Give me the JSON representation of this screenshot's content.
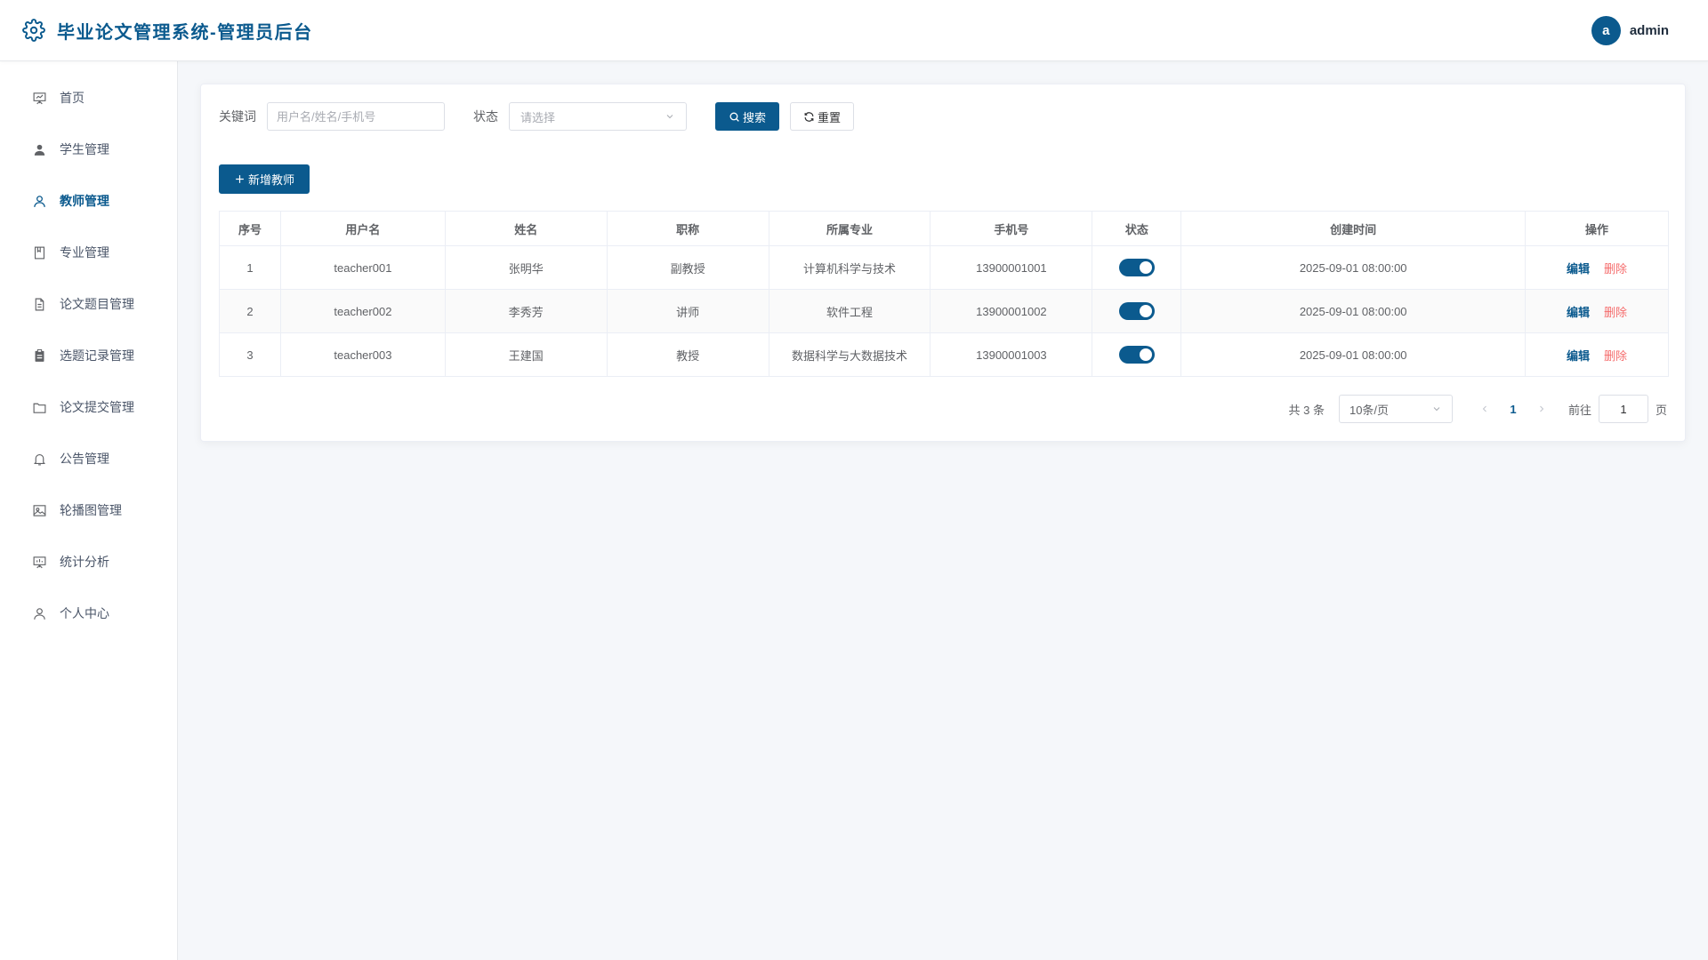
{
  "header": {
    "title": "毕业论文管理系统-管理员后台",
    "avatar_letter": "a",
    "username": "admin"
  },
  "sidebar": {
    "items": [
      {
        "label": "首页",
        "icon": "presentation-icon",
        "active": false
      },
      {
        "label": "学生管理",
        "icon": "user-filled-icon",
        "active": false
      },
      {
        "label": "教师管理",
        "icon": "user-icon",
        "active": true
      },
      {
        "label": "专业管理",
        "icon": "notebook-icon",
        "active": false
      },
      {
        "label": "论文题目管理",
        "icon": "document-icon",
        "active": false
      },
      {
        "label": "选题记录管理",
        "icon": "clipboard-icon",
        "active": false
      },
      {
        "label": "论文提交管理",
        "icon": "folder-icon",
        "active": false
      },
      {
        "label": "公告管理",
        "icon": "bell-icon",
        "active": false
      },
      {
        "label": "轮播图管理",
        "icon": "picture-icon",
        "active": false
      },
      {
        "label": "统计分析",
        "icon": "data-board-icon",
        "active": false
      },
      {
        "label": "个人中心",
        "icon": "user-icon",
        "active": false
      }
    ]
  },
  "filter": {
    "keyword_label": "关键词",
    "keyword_placeholder": "用户名/姓名/手机号",
    "keyword_value": "",
    "status_label": "状态",
    "status_placeholder": "请选择",
    "search_label": "搜索",
    "reset_label": "重置"
  },
  "add_button_label": "新增教师",
  "table": {
    "columns": [
      "序号",
      "用户名",
      "姓名",
      "职称",
      "所属专业",
      "手机号",
      "状态",
      "创建时间",
      "操作"
    ],
    "rows": [
      {
        "index": "1",
        "username": "teacher001",
        "name": "张明华",
        "title": "副教授",
        "major": "计算机科学与技术",
        "phone": "13900001001",
        "enabled": true,
        "created": "2025-09-01 08:00:00"
      },
      {
        "index": "2",
        "username": "teacher002",
        "name": "李秀芳",
        "title": "讲师",
        "major": "软件工程",
        "phone": "13900001002",
        "enabled": true,
        "created": "2025-09-01 08:00:00"
      },
      {
        "index": "3",
        "username": "teacher003",
        "name": "王建国",
        "title": "教授",
        "major": "数据科学与大数据技术",
        "phone": "13900001003",
        "enabled": true,
        "created": "2025-09-01 08:00:00"
      }
    ],
    "edit_label": "编辑",
    "delete_label": "删除"
  },
  "pagination": {
    "total_text": "共 3 条",
    "page_size": "10条/页",
    "current_page": "1",
    "goto_label": "前往",
    "goto_value": "1",
    "page_suffix": "页"
  },
  "colors": {
    "primary": "#0b5a8e",
    "danger": "#f56c6c"
  }
}
